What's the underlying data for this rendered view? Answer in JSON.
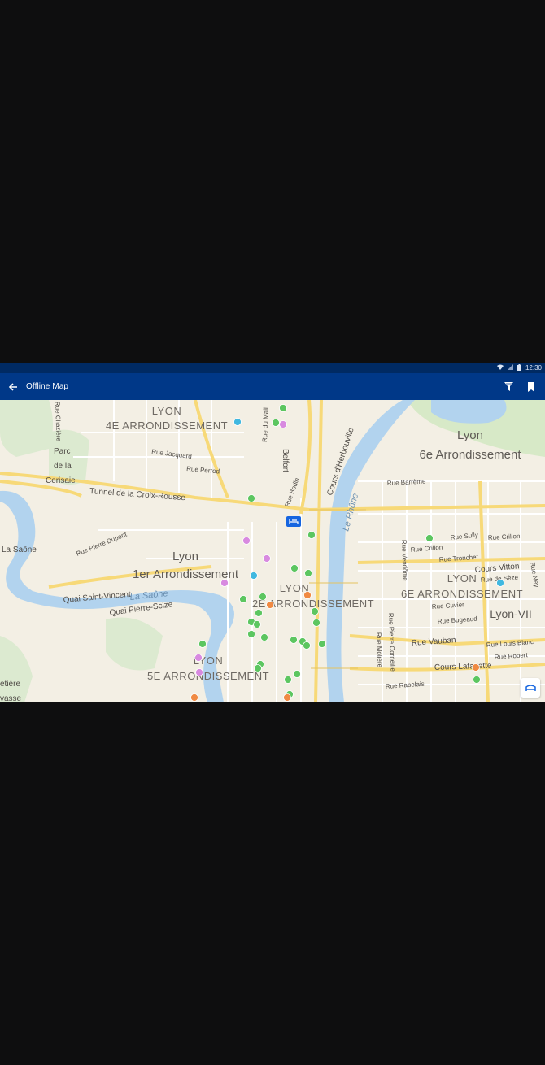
{
  "status_bar": {
    "time": "12:30",
    "icons": [
      "wifi-icon",
      "signal-icon",
      "battery-icon"
    ]
  },
  "app_bar": {
    "title": "Offline Map",
    "back_icon": "arrow-left-icon",
    "actions": [
      {
        "name": "filter-icon"
      },
      {
        "name": "bookmark-icon"
      }
    ]
  },
  "map": {
    "districts": {
      "lyon4_a": "LYON",
      "lyon4_b": "4E ARRONDISSEMENT",
      "lyon6_a": "Lyon",
      "lyon6_b": "6e Arrondissement",
      "lyon1_a": "Lyon",
      "lyon1_b": "1er Arrondissement",
      "lyon2_a": "LYON",
      "lyon2_b": "2E ARRONDISSEMENT",
      "lyon6c_a": "LYON",
      "lyon6c_b": "6E ARRONDISSEMENT",
      "lyon5_a": "LYON",
      "lyon5_b": "5E ARRONDISSEMENT",
      "lyon7": "Lyon-VII"
    },
    "streets": {
      "tunnel": "Tunnel de la Croix-Rousse",
      "quai_sv": "Quai Saint-Vincent",
      "quai_ps": "Quai Pierre-Scize",
      "rue_vauban": "Rue Vauban",
      "cours_lafayette": "Cours Lafayette",
      "cours_vitton": "Cours Vitton",
      "cours_herbouville": "Cours d'Herbouville",
      "belfort": "Belfort",
      "la_saone": "La Saône",
      "rue_jacquard": "Rue Jacquard",
      "rue_perrod": "Rue Perrod",
      "rue_chazière": "Rue Chazière",
      "rue_du_mail": "Rue du Mail",
      "rue_bodin": "Rue Bodin",
      "rue_barrème": "Rue Barrème",
      "rue_pierre_dupont": "Rue Pierre Dupont",
      "rue_sully": "Rue Sully",
      "rue_crillon1": "Rue Crillon",
      "rue_crillon2": "Rue Crillon",
      "rue_tronchet": "Rue Tronchet",
      "rue_de_seze": "Rue de Sèze",
      "rue_ney": "Rue Ney",
      "rue_cuvier": "Rue Cuvier",
      "rue_bugeaud": "Rue Bugeaud",
      "rue_vendome": "Rue Vendôme",
      "rue_pierre_corneille": "Rue Pierre Corneille",
      "rue_moliere": "Rue Molière",
      "rue_louis_blanc": "Rue Louis Blanc",
      "rue_robert": "Rue Robert",
      "rue_rabelais": "Rue Rabelais",
      "parc_1": "Parc",
      "parc_2": "de la",
      "parc_3": "Cerisaie",
      "saone_water": "La Saône",
      "rhone_water": "Le Rhône",
      "cimetiere_1": "etière",
      "cimetiere_2": "vasse"
    },
    "colors": {
      "land": "#f3efe4",
      "water": "#b2d3ee",
      "park": "#d7e9c7",
      "major_road": "#f7d978",
      "minor_road": "#ffffff",
      "poi_green": "#5cc660",
      "poi_pink": "#d88ae0",
      "poi_orange": "#f08a43",
      "poi_cyan": "#40b8e0",
      "hotel_blue": "#1565e0"
    }
  },
  "map_control": {
    "icon": "bed-icon"
  }
}
